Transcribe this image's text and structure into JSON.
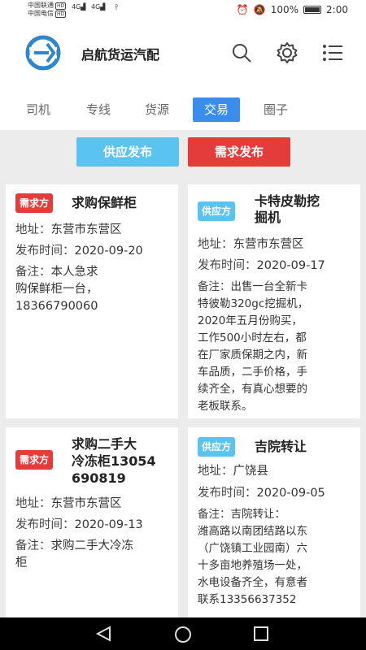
{
  "status_bar": {
    "carrier_1": "中国联通",
    "carrier_2": "中国电信",
    "hd": "HD",
    "signal_1": "4G",
    "signal_2": "4G",
    "battery": "100%",
    "time": "2:00"
  },
  "header": {
    "title": "启航货运汽配",
    "icons": [
      "logo-icon",
      "search-icon",
      "gear-icon",
      "menu-list-icon"
    ]
  },
  "tabs": [
    {
      "label": "司机",
      "active": false
    },
    {
      "label": "专线",
      "active": false
    },
    {
      "label": "货源",
      "active": false
    },
    {
      "label": "交易",
      "active": true
    },
    {
      "label": "圈子",
      "active": false
    }
  ],
  "actions": {
    "supply_label": "供应发布",
    "demand_label": "需求发布"
  },
  "labels": {
    "address": "地址：",
    "publish_time": "发布时间：",
    "note": "备注："
  },
  "cards": [
    {
      "badge": "需求方",
      "badge_type": "demand",
      "title_lines": [
        "求购保鲜柜"
      ],
      "address": "东营市东营区",
      "time": "2020-09-20",
      "note_lines": [
        "本人急求",
        "购保鲜柜一台，",
        "18366790060"
      ]
    },
    {
      "badge": "供应方",
      "badge_type": "supply",
      "title_lines": [
        "卡特皮勒挖",
        "掘机"
      ],
      "address": "东营市东营区",
      "time": "2020-09-17",
      "note_lines": [
        "出售一台全新卡",
        "特彼勒320gc挖掘机，",
        "2020年五月份购买，",
        "工作500小时左右，都",
        "在厂家质保期之内，新",
        "车品质，二手价格，手",
        "续齐全，有真心想要的",
        "老板联系。"
      ]
    },
    {
      "badge": "需求方",
      "badge_type": "demand",
      "title_lines": [
        "求购二手大",
        "冷冻柜13054",
        "690819"
      ],
      "address": "东营市东营区",
      "time": "2020-09-13",
      "note_lines": [
        "求购二手大冷冻",
        "柜"
      ]
    },
    {
      "badge": "供应方",
      "badge_type": "supply",
      "title_lines": [
        "吉院转让"
      ],
      "address": "广饶县",
      "time": "2020-09-05",
      "note_lines": [
        "吉院转让：",
        "潍高路以南团结路以东",
        "（广饶镇工业园南）六",
        "十多亩地养殖场一处，",
        "水电设备齐全，有意者",
        "联系13356637352"
      ]
    }
  ],
  "colors": {
    "accent": "#3b8dec",
    "supply": "#5bc3f0",
    "demand": "#e43b3b",
    "background": "#ececec"
  }
}
